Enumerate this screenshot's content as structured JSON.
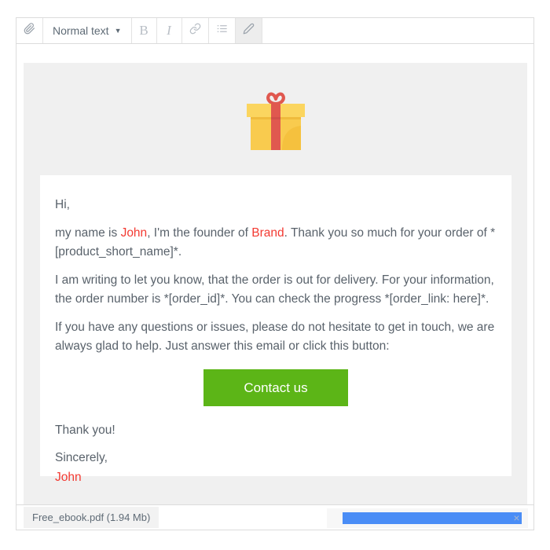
{
  "toolbar": {
    "attach_icon": "paperclip-icon",
    "style_label": "Normal text",
    "caret": "▼",
    "bold_label": "B",
    "italic_label": "I",
    "link_icon": "link-icon",
    "list_icon": "bullet-list-icon",
    "pencil_icon": "pencil-icon"
  },
  "hero": {
    "icon": "gift-box-icon",
    "colors": {
      "box_light": "#fbd55f",
      "box_mid": "#f9cb4e",
      "box_shade": "#f5c13e",
      "ribbon": "#e0584f",
      "ribbon_dark": "#d1504a",
      "bow": "#e0584f"
    }
  },
  "email": {
    "greeting": "Hi,",
    "paragraph_1": {
      "pre": "my name is ",
      "name": "John",
      "mid": ", I'm the founder of ",
      "brand": "Brand",
      "post": ". Thank you so much for your order of *[product_short_name]*."
    },
    "paragraph_2": "I am writing to let you know, that the order is out for delivery. For your information, the order number is *[order_id]*. You can check the progress *[order_link: here]*.",
    "paragraph_3": "If you have any questions or issues, please do not hesitate to get in touch, we are always glad to help. Just answer this email or click this button:",
    "cta_label": "Contact us",
    "cta_color": "#5cb517",
    "thanks": "Thank you!",
    "closing": "Sincerely,",
    "signature": "John",
    "accent_color": "#f33a32"
  },
  "attachment": {
    "file_label": "Free_ebook.pdf (1.94 Mb)",
    "progress_percent": 100,
    "progress_color": "#4a8df6",
    "close_icon": "×"
  }
}
